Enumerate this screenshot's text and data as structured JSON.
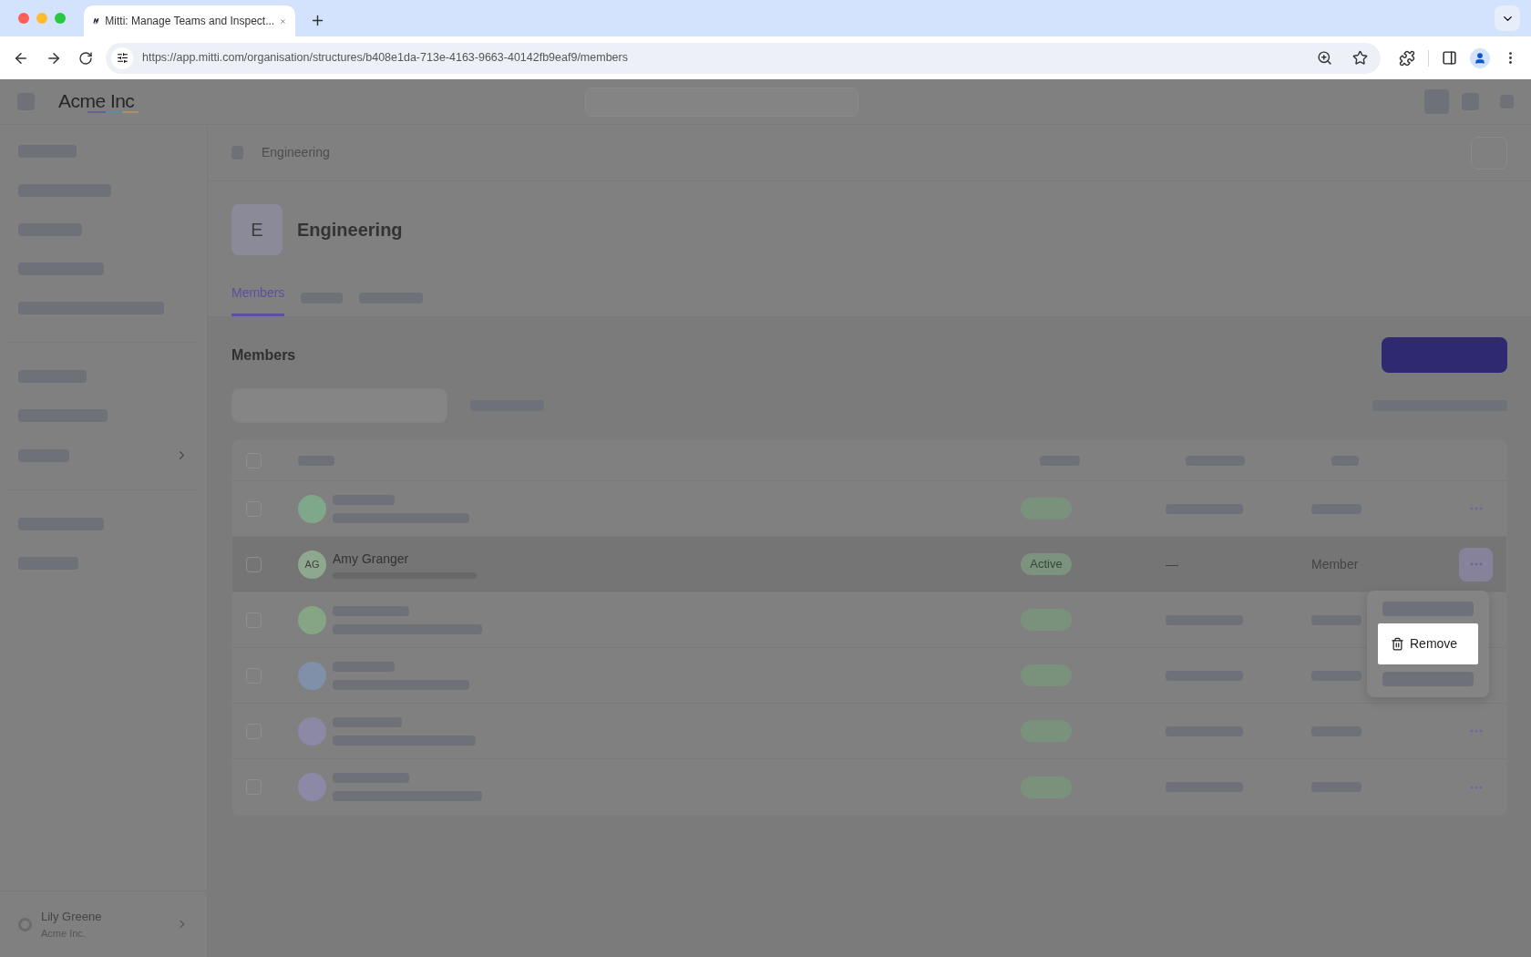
{
  "browser": {
    "tab_title": "Mitti: Manage Teams and Inspect...",
    "url": "https://app.mitti.com/organisation/structures/b408e1da-713e-4163-9663-40142fb9eaf9/members"
  },
  "app": {
    "logo": "Acme Inc"
  },
  "sidebar": {
    "user": {
      "name": "Lily Greene",
      "org": "Acme Inc."
    }
  },
  "breadcrumb": {
    "label": "Engineering"
  },
  "team": {
    "avatar": "E",
    "title": "Engineering"
  },
  "tabs": [
    {
      "kind": "text",
      "label": "Members",
      "selected": true
    },
    {
      "kind": "placeholder",
      "selected": false
    },
    {
      "kind": "placeholder",
      "selected": false
    }
  ],
  "section": {
    "title": "Members"
  },
  "select_all": {
    "checked": false
  },
  "rows": [
    {
      "kind": "placeholder",
      "color": "#7fa88a",
      "checked": false,
      "selected": false
    },
    {
      "kind": "member",
      "initials": "AG",
      "name": "Amy Granger",
      "status": "Active",
      "column_3": "—",
      "role": "Member",
      "color": "#8ea88f",
      "checked": false,
      "selected": true
    },
    {
      "kind": "placeholder",
      "color": "#86a585",
      "checked": false,
      "selected": false
    },
    {
      "kind": "placeholder",
      "color": "#7f90a8",
      "checked": false,
      "selected": false
    },
    {
      "kind": "placeholder",
      "color": "#8b89a6",
      "checked": false,
      "selected": false
    },
    {
      "kind": "placeholder",
      "color": "#8b89a6",
      "checked": false,
      "selected": false
    }
  ],
  "menu": {
    "items": [
      {
        "kind": "placeholder"
      },
      {
        "kind": "action",
        "label": "Remove"
      },
      {
        "kind": "placeholder"
      }
    ]
  }
}
